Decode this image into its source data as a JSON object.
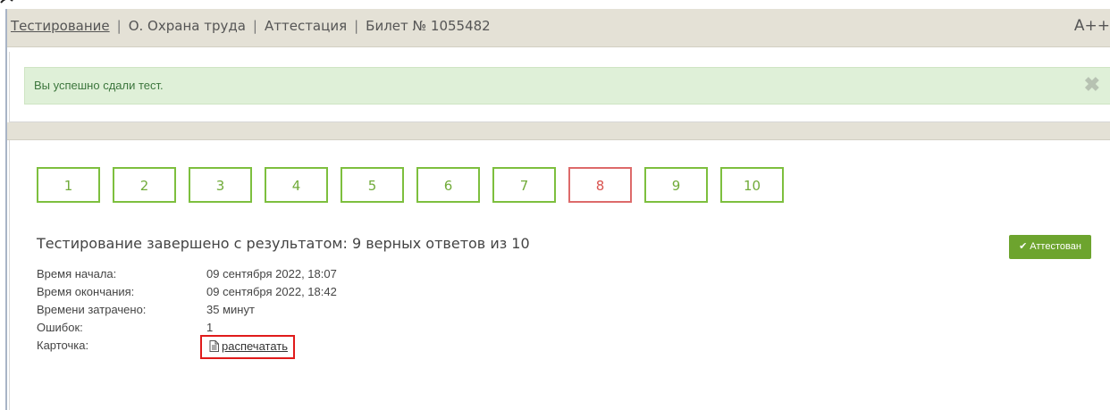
{
  "header": {
    "breadcrumbs": [
      "Тестирование",
      "О. Охрана труда",
      "Аттестация",
      "Билет № 1055482"
    ],
    "font_size_control": "A++"
  },
  "alert": {
    "message": "Вы успешно сдали тест.",
    "close_icon": "close-icon"
  },
  "questions": [
    {
      "number": "1",
      "status": "correct"
    },
    {
      "number": "2",
      "status": "correct"
    },
    {
      "number": "3",
      "status": "correct"
    },
    {
      "number": "4",
      "status": "correct"
    },
    {
      "number": "5",
      "status": "correct"
    },
    {
      "number": "6",
      "status": "correct"
    },
    {
      "number": "7",
      "status": "correct"
    },
    {
      "number": "8",
      "status": "wrong"
    },
    {
      "number": "9",
      "status": "correct"
    },
    {
      "number": "10",
      "status": "correct"
    }
  ],
  "result": {
    "title": "Тестирование завершено с результатом: 9 верных ответов из 10",
    "badge": "Аттестован"
  },
  "details": {
    "start_label": "Время начала:",
    "start_value": "09 сентября 2022, 18:07",
    "end_label": "Время окончания:",
    "end_value": "09 сентября 2022, 18:42",
    "spent_label": "Времени затрачено:",
    "spent_value": "35 минут",
    "errors_label": "Ошибок:",
    "errors_value": "1",
    "card_label": "Карточка:",
    "print_label": "распечатать"
  },
  "colors": {
    "correct": "#7dbf3e",
    "wrong": "#dd6a6a",
    "alert_bg": "#dff0d8",
    "badge_bg": "#6da42e",
    "highlight": "#e01b1b"
  }
}
